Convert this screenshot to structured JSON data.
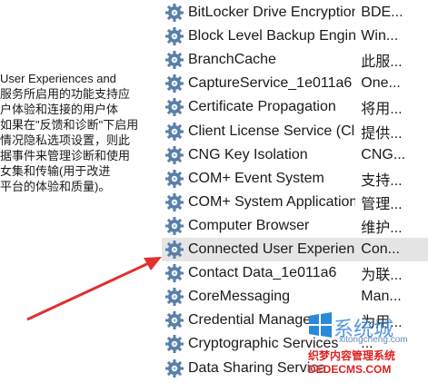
{
  "description_lines": [
    "User Experiences and",
    "服务所启用的功能支持应",
    "户体验和连接的用户体",
    "如果在\"反馈和诊断\"下启用",
    "情况隐私选项设置，则此",
    "据事件来管理诊断和使用",
    "女集和传输(用于改进",
    "平台的体验和质量)。"
  ],
  "services": [
    {
      "name": "BitLocker Drive Encryption ...",
      "desc": "BDE..."
    },
    {
      "name": "Block Level Backup Engine ...",
      "desc": "Win..."
    },
    {
      "name": "BranchCache",
      "desc": "此服..."
    },
    {
      "name": "CaptureService_1e011a6",
      "desc": "One..."
    },
    {
      "name": "Certificate Propagation",
      "desc": "将用..."
    },
    {
      "name": "Client License Service (Clip...",
      "desc": "提供..."
    },
    {
      "name": "CNG Key Isolation",
      "desc": "CNG..."
    },
    {
      "name": "COM+ Event System",
      "desc": "支持..."
    },
    {
      "name": "COM+ System Application",
      "desc": "管理..."
    },
    {
      "name": "Computer Browser",
      "desc": "维护..."
    },
    {
      "name": "Connected User Experienc...",
      "desc": "Con..."
    },
    {
      "name": "Contact Data_1e011a6",
      "desc": "为联..."
    },
    {
      "name": "CoreMessaging",
      "desc": "Man..."
    },
    {
      "name": "Credential Manager",
      "desc": "为用..."
    },
    {
      "name": "Cryptographic Services",
      "desc": "..."
    },
    {
      "name": "Data Sharing Service",
      "desc": ""
    }
  ],
  "selected_index": 10,
  "colors": {
    "arrow": "#e03030",
    "selected_bg": "#e5e5e5",
    "gear": "#5a7fa8"
  },
  "icon_name": "gear-service-icon",
  "watermark": {
    "big": "系统城",
    "url": "xitongcheng.com",
    "sub": "织梦内容管理系统",
    "sub2": "DEDECMS.COM"
  }
}
